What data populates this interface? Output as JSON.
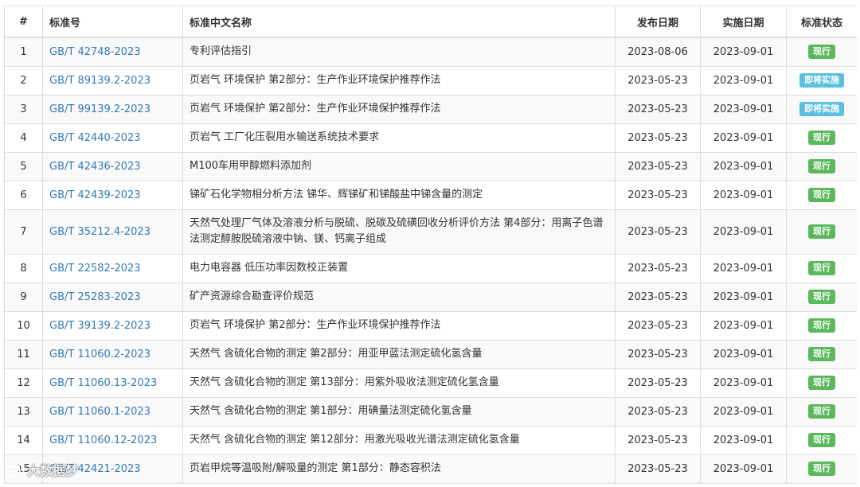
{
  "table": {
    "headers": [
      "#",
      "标准号",
      "标准中文名称",
      "发布日期",
      "实施日期",
      "标准状态"
    ],
    "rows": [
      {
        "idx": "1",
        "code": "GB/T 42748-2023",
        "name": "专利评估指引",
        "pub": "2023-08-06",
        "impl": "2023-09-01",
        "status": "现行",
        "status_type": "current"
      },
      {
        "idx": "2",
        "code": "GB/T 89139.2-2023",
        "name": "页岩气 环境保护 第2部分：生产作业环境保护推荐作法",
        "pub": "2023-05-23",
        "impl": "2023-09-01",
        "status": "即将实施",
        "status_type": "upcoming"
      },
      {
        "idx": "3",
        "code": "GB/T 99139.2-2023",
        "name": "页岩气 环境保护 第2部分：生产作业环境保护推荐作法",
        "pub": "2023-05-23",
        "impl": "2023-09-01",
        "status": "即将实施",
        "status_type": "upcoming"
      },
      {
        "idx": "4",
        "code": "GB/T 42440-2023",
        "name": "页岩气 工厂化压裂用水输送系统技术要求",
        "pub": "2023-05-23",
        "impl": "2023-09-01",
        "status": "现行",
        "status_type": "current"
      },
      {
        "idx": "5",
        "code": "GB/T 42436-2023",
        "name": "M100车用甲醇燃料添加剂",
        "pub": "2023-05-23",
        "impl": "2023-09-01",
        "status": "现行",
        "status_type": "current"
      },
      {
        "idx": "6",
        "code": "GB/T 42439-2023",
        "name": "锑矿石化学物相分析方法 锑华、辉锑矿和锑酸盐中锑含量的测定",
        "pub": "2023-05-23",
        "impl": "2023-09-01",
        "status": "现行",
        "status_type": "current"
      },
      {
        "idx": "7",
        "code": "GB/T 35212.4-2023",
        "name": "天然气处理厂气体及溶液分析与脱硫、脱碳及硫磺回收分析评价方法 第4部分：用离子色谱法测定醇胺脱硫溶液中钠、镁、钙离子组成",
        "pub": "2023-05-23",
        "impl": "2023-09-01",
        "status": "现行",
        "status_type": "current",
        "tall": true
      },
      {
        "idx": "8",
        "code": "GB/T 22582-2023",
        "name": "电力电容器 低压功率因数校正装置",
        "pub": "2023-05-23",
        "impl": "2023-09-01",
        "status": "现行",
        "status_type": "current"
      },
      {
        "idx": "9",
        "code": "GB/T 25283-2023",
        "name": "矿产资源综合勘查评价规范",
        "pub": "2023-05-23",
        "impl": "2023-09-01",
        "status": "现行",
        "status_type": "current"
      },
      {
        "idx": "10",
        "code": "GB/T 39139.2-2023",
        "name": "页岩气 环境保护 第2部分：生产作业环境保护推荐作法",
        "pub": "2023-05-23",
        "impl": "2023-09-01",
        "status": "现行",
        "status_type": "current"
      },
      {
        "idx": "11",
        "code": "GB/T 11060.2-2023",
        "name": "天然气 含硫化合物的测定 第2部分：用亚甲蓝法测定硫化氢含量",
        "pub": "2023-05-23",
        "impl": "2023-09-01",
        "status": "现行",
        "status_type": "current"
      },
      {
        "idx": "12",
        "code": "GB/T 11060.13-2023",
        "name": "天然气 含硫化合物的测定 第13部分：用紫外吸收法测定硫化氢含量",
        "pub": "2023-05-23",
        "impl": "2023-09-01",
        "status": "现行",
        "status_type": "current"
      },
      {
        "idx": "13",
        "code": "GB/T 11060.1-2023",
        "name": "天然气 含硫化合物的测定 第1部分：用碘量法测定硫化氢含量",
        "pub": "2023-05-23",
        "impl": "2023-09-01",
        "status": "现行",
        "status_type": "current"
      },
      {
        "idx": "14",
        "code": "GB/T 11060.12-2023",
        "name": "天然气 含硫化合物的测定 第12部分：用激光吸收光谱法测定硫化氢含量",
        "pub": "2023-05-23",
        "impl": "2023-09-01",
        "status": "现行",
        "status_type": "current"
      },
      {
        "idx": "15",
        "code": "GB/T 42421-2023",
        "name": "页岩甲烷等温吸附/解吸量的测定 第1部分：静态容积法",
        "pub": "2023-05-23",
        "impl": "2023-09-01",
        "status": "现行",
        "status_type": "current"
      }
    ]
  },
  "watermark": {
    "text": "大数据梦",
    "icon": "weibo-logo-icon"
  },
  "colors": {
    "link": "#337ab7",
    "status_current": "#5cb85c",
    "status_upcoming": "#5bc0de",
    "border": "#dddddd",
    "stripe": "#f9f9f9"
  }
}
